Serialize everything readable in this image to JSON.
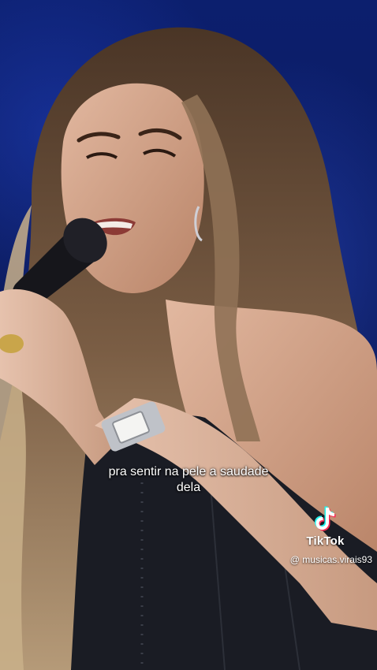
{
  "caption": {
    "line1": "pra sentir na pele a saudade",
    "line2": "dela"
  },
  "watermark": {
    "icon": "tiktok-note-icon",
    "brand": "TikTok",
    "handle": "@ musicas.virais93"
  },
  "colors": {
    "background": "#0b1a5a",
    "tiktok_cyan": "#25F4EE",
    "tiktok_red": "#FE2C55"
  }
}
